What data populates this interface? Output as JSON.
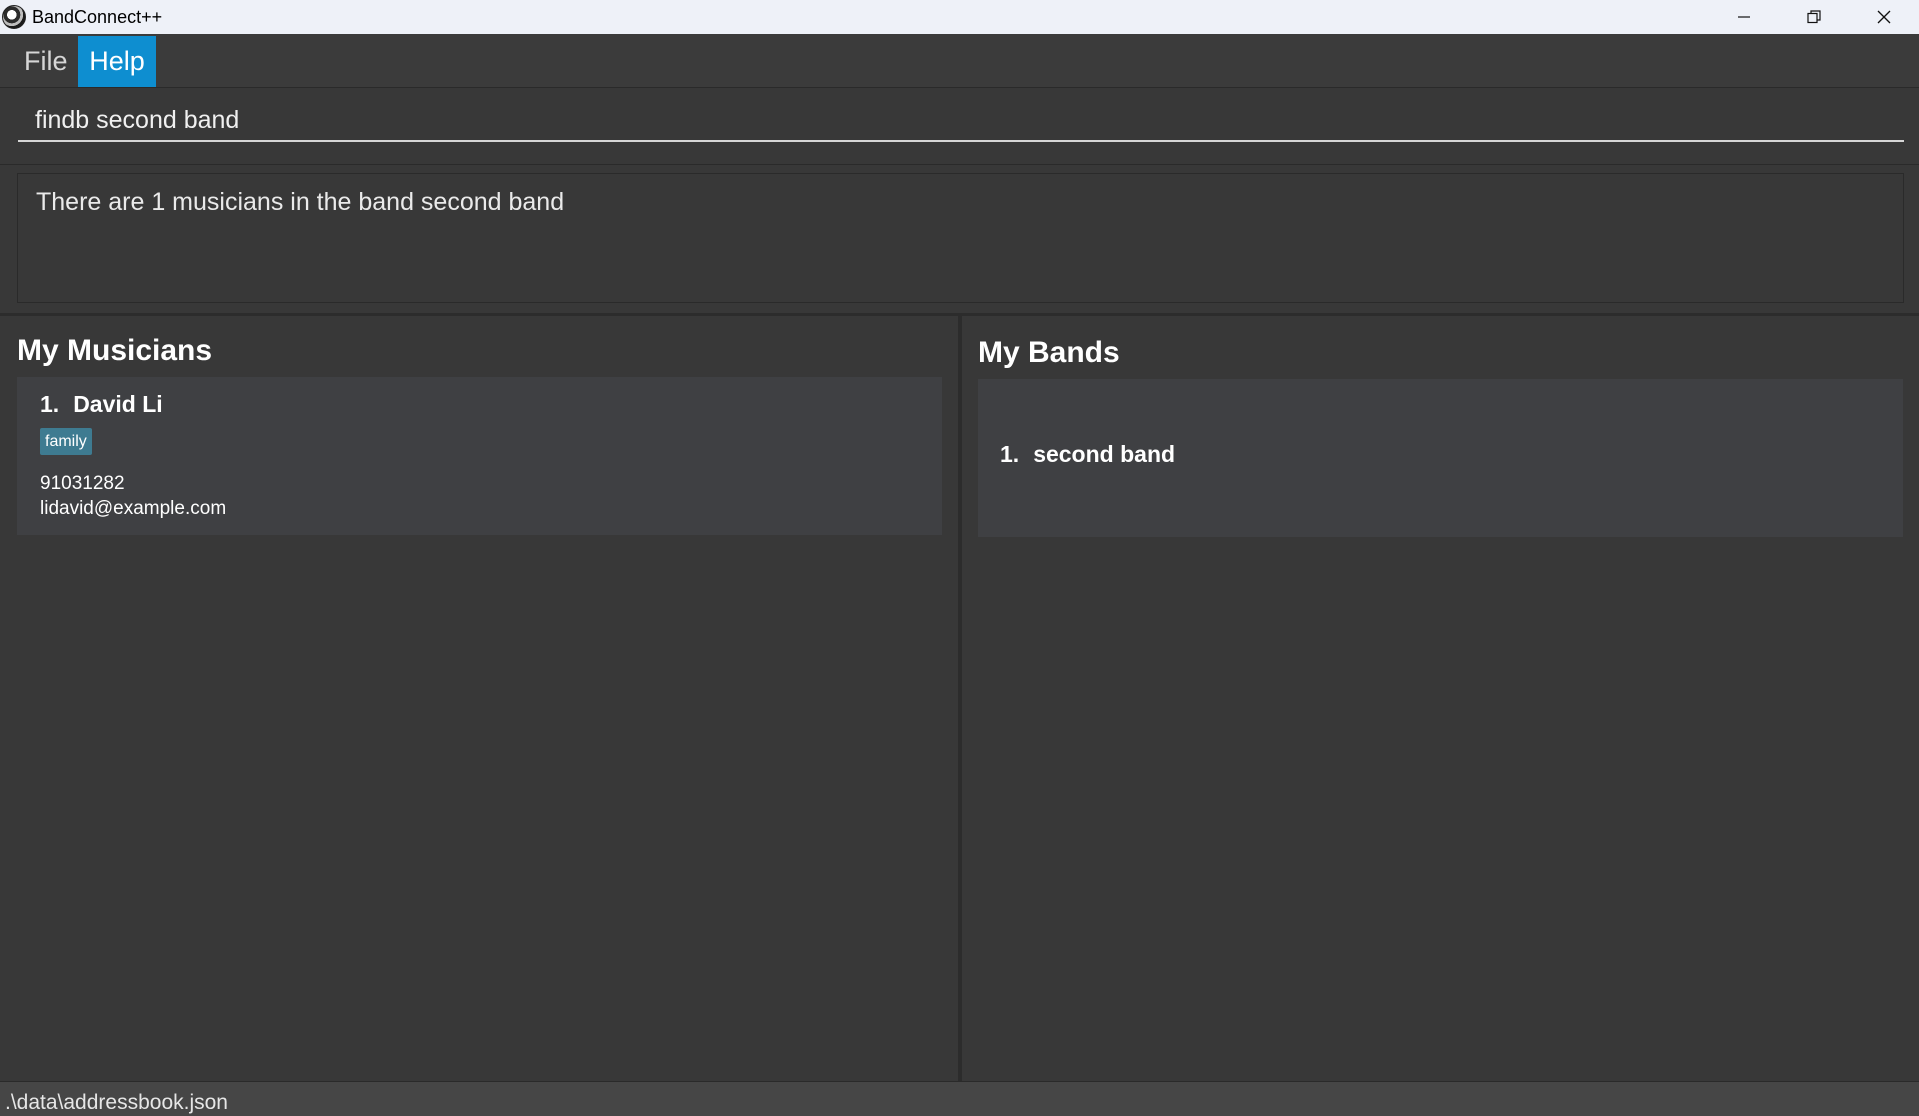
{
  "window": {
    "title": "BandConnect++",
    "icon": "app-logo-icon",
    "controls": [
      "minimize-icon",
      "restore-icon",
      "close-icon"
    ]
  },
  "menu": {
    "items": [
      {
        "label": "File"
      },
      {
        "label": "Help"
      }
    ]
  },
  "command": {
    "value": "findb second band"
  },
  "result": {
    "text": "There are 1 musicians in the band second band"
  },
  "musicians": {
    "title": "My Musicians",
    "items": [
      {
        "index": "1.",
        "name": "David Li",
        "tags": [
          "family"
        ],
        "phone": "91031282",
        "email": "lidavid@example.com"
      }
    ]
  },
  "bands": {
    "title": "My Bands",
    "items": [
      {
        "index": "1.",
        "name": "second band"
      }
    ]
  },
  "status": {
    "path": ".\\data\\addressbook.json"
  },
  "colors": {
    "background": "#383838",
    "menu_highlight": "#0e8ed0",
    "tag": "#3e7b91",
    "card": "#3f4043"
  }
}
